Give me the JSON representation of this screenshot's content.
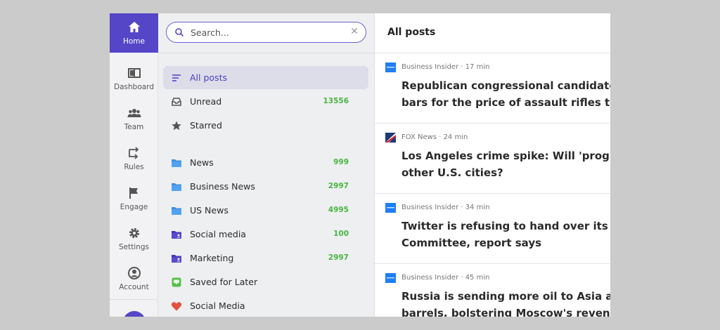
{
  "nav": {
    "items": [
      {
        "label": "Home",
        "icon": "home-icon",
        "active": true
      },
      {
        "label": "Dashboard",
        "icon": "dashboard-icon"
      },
      {
        "label": "Team",
        "icon": "team-icon"
      },
      {
        "label": "Rules",
        "icon": "rules-icon"
      },
      {
        "label": "Engage",
        "icon": "flag-icon"
      },
      {
        "label": "Settings",
        "icon": "gear-icon"
      },
      {
        "label": "Account",
        "icon": "account-icon"
      }
    ],
    "accent": "#5546c8"
  },
  "search": {
    "placeholder": "Search...",
    "value": ""
  },
  "feeds": {
    "items": [
      {
        "label": "All posts",
        "icon": "list-icon",
        "count": "",
        "active": true
      },
      {
        "label": "Unread",
        "icon": "inbox-icon",
        "count": "13556"
      },
      {
        "label": "Starred",
        "icon": "star-icon",
        "count": ""
      },
      {
        "label": "News",
        "icon": "folder-icon",
        "count": "999"
      },
      {
        "label": "Business News",
        "icon": "folder-icon",
        "count": "2997"
      },
      {
        "label": "US News",
        "icon": "folder-icon",
        "count": "4995"
      },
      {
        "label": "Social media",
        "icon": "folder-person-icon",
        "count": "100"
      },
      {
        "label": "Marketing",
        "icon": "folder-person-icon",
        "count": "2997"
      },
      {
        "label": "Saved for Later",
        "icon": "saved-tray-icon",
        "count": ""
      },
      {
        "label": "Social Media",
        "icon": "heart-icon",
        "count": ""
      }
    ],
    "count_color": "#48b540"
  },
  "posts": {
    "title": "All posts",
    "items": [
      {
        "source": "Business Insider · 17 min",
        "title_line1": "Republican congressional candidate su",
        "title_line2": "bars for the price of assault rifles to ci",
        "icon": "business-insider-icon"
      },
      {
        "source": "FOX News · 24 min",
        "title_line1": "Los Angeles crime spike: Will 'progress",
        "title_line2": "other U.S. cities?",
        "icon": "fox-news-icon"
      },
      {
        "source": "Business Insider · 34 min",
        "title_line1": "Twitter is refusing to hand over its inte",
        "title_line2": "Committee, report says",
        "icon": "business-insider-icon"
      },
      {
        "source": "Business Insider · 45 min",
        "title_line1": "Russia is sending more oil to Asia as Cl",
        "title_line2": "barrels, bolstering Moscow's revenues",
        "icon": "business-insider-icon"
      }
    ]
  }
}
